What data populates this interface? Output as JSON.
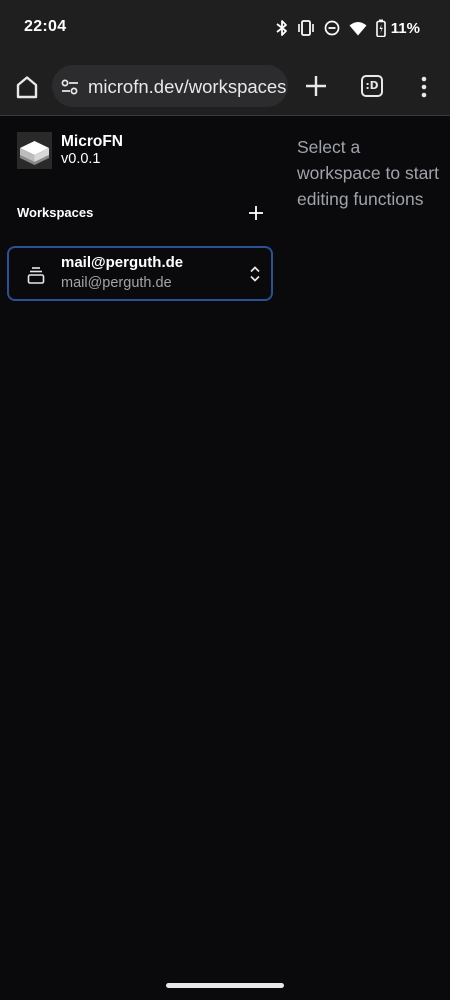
{
  "status_bar": {
    "time": "22:04",
    "icons": [
      "bluetooth-icon",
      "vibrate-icon",
      "do-not-disturb-icon",
      "wifi-icon",
      "battery-icon"
    ],
    "battery_percent": "11%"
  },
  "browser": {
    "url": "microfn.dev/workspaces",
    "tabs_label": ":D",
    "icons": [
      "home-icon",
      "tune-icon",
      "plus-icon",
      "tabs-icon",
      "more-vert-icon"
    ]
  },
  "app": {
    "name": "MicroFN",
    "version": "v0.0.1"
  },
  "sidebar": {
    "workspaces_title": "Workspaces",
    "workspaces": [
      {
        "name": "mail@perguth.de",
        "email": "mail@perguth.de",
        "selected": true
      }
    ]
  },
  "main": {
    "placeholder": "Select a workspace to start editing functions"
  },
  "colors": {
    "background": "#0a0a0c",
    "chrome": "#1f1f1f",
    "selected_border": "#2d4f94",
    "muted_text": "#9fa3ab"
  }
}
